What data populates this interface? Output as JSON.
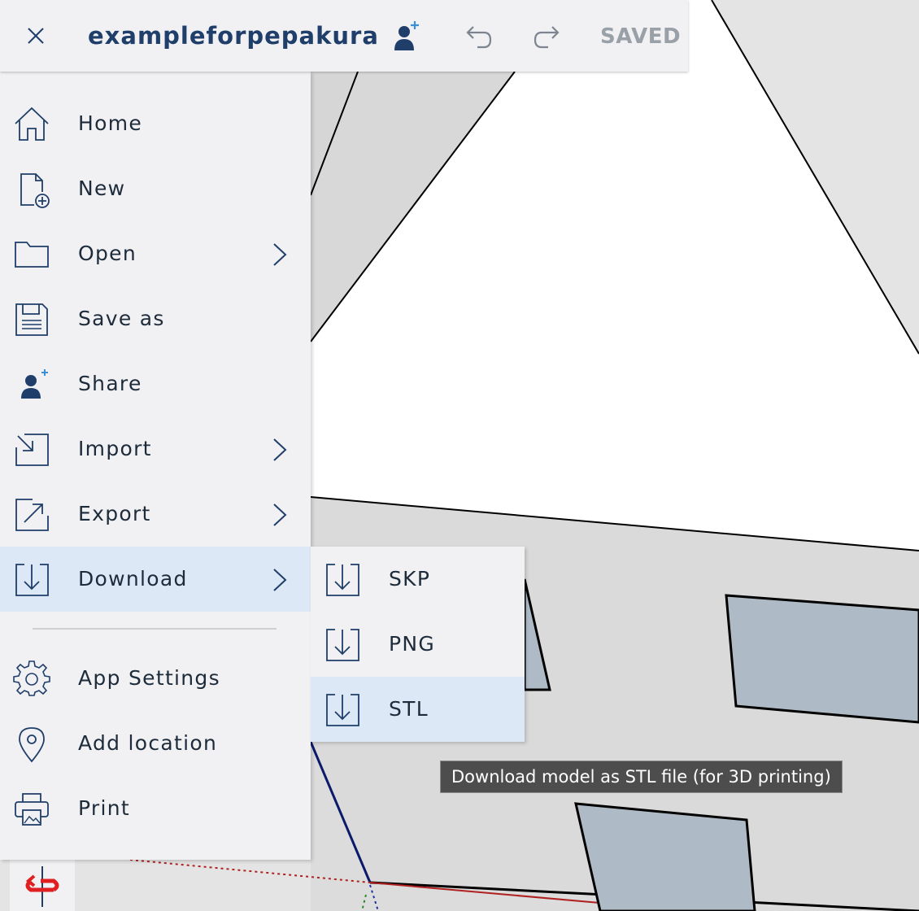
{
  "app": {
    "title": "exampleforpepakura",
    "save_status": "SAVED"
  },
  "toolbar": {
    "close_icon": "close-icon",
    "share_icon": "add-user-icon",
    "undo_icon": "undo-icon",
    "redo_icon": "redo-icon"
  },
  "menu": {
    "items": [
      {
        "label": "Home",
        "icon": "home-icon"
      },
      {
        "label": "New",
        "icon": "new-file-icon"
      },
      {
        "label": "Open",
        "icon": "folder-icon",
        "submenu": true
      },
      {
        "label": "Save as",
        "icon": "floppy-icon"
      },
      {
        "label": "Share",
        "icon": "add-user-icon"
      },
      {
        "label": "Import",
        "icon": "import-icon",
        "submenu": true
      },
      {
        "label": "Export",
        "icon": "export-icon",
        "submenu": true
      },
      {
        "label": "Download",
        "icon": "download-icon",
        "submenu": true,
        "active": true
      },
      {
        "label": "App Settings",
        "icon": "gear-icon"
      },
      {
        "label": "Add location",
        "icon": "location-pin-icon"
      },
      {
        "label": "Print",
        "icon": "printer-icon"
      }
    ]
  },
  "download_submenu": {
    "items": [
      {
        "label": "SKP",
        "icon": "download-icon"
      },
      {
        "label": "PNG",
        "icon": "download-icon"
      },
      {
        "label": "STL",
        "icon": "download-icon",
        "active": true
      }
    ]
  },
  "tooltip": {
    "text": "Download model as STL file (for 3D printing)"
  },
  "colors": {
    "accent": "#1f3e6a",
    "panel": "#f1f1f4",
    "active_row": "#dce8f5",
    "share_plus": "#3a8fd6"
  }
}
